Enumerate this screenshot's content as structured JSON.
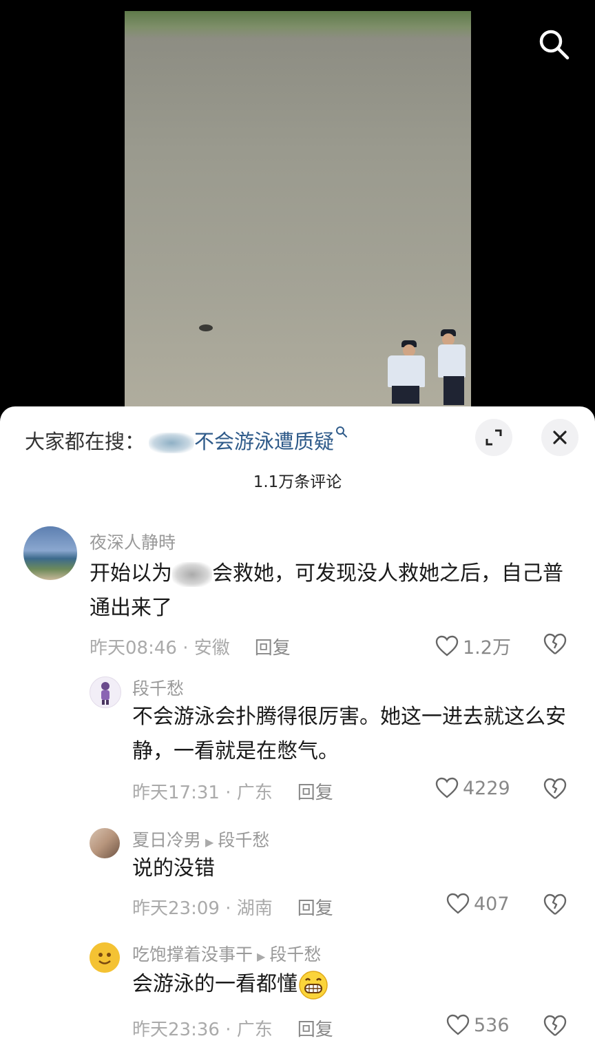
{
  "hot_search": {
    "prefix": "大家都在搜：",
    "keyword": "不会游泳遭质疑"
  },
  "comment_count": "1.1万条评论",
  "comments": [
    {
      "user": "夜深人静時",
      "text_a": "开始以为",
      "text_b": "会救她，可发现没人救她之后，自己普通出来了",
      "time": "昨天08:46",
      "location": "安徽",
      "reply_label": "回复",
      "likes": "1.2万"
    },
    {
      "user": "段千愁",
      "text": "不会游泳会扑腾得很厉害。她这一进去就这么安静，一看就是在憋气。",
      "time": "昨天17:31",
      "location": "广东",
      "reply_label": "回复",
      "likes": "4229"
    },
    {
      "user": "夏日冷男",
      "reply_to": "段千愁",
      "text": "说的没错",
      "time": "昨天23:09",
      "location": "湖南",
      "reply_label": "回复",
      "likes": "407"
    },
    {
      "user": "吃饱撑着没事干",
      "reply_to": "段千愁",
      "text": "会游泳的一看都懂",
      "time": "昨天23:36",
      "location": "广东",
      "reply_label": "回复",
      "likes": "536"
    }
  ],
  "icons": [
    "search-icon",
    "expand-icon",
    "close-icon",
    "heart-icon",
    "broken-heart-icon",
    "grin-emoji"
  ],
  "colors": {
    "keyword": "#2f5b8a",
    "text": "#1a1a1a",
    "meta": "#aaaaaa",
    "sheet": "#ffffff"
  }
}
